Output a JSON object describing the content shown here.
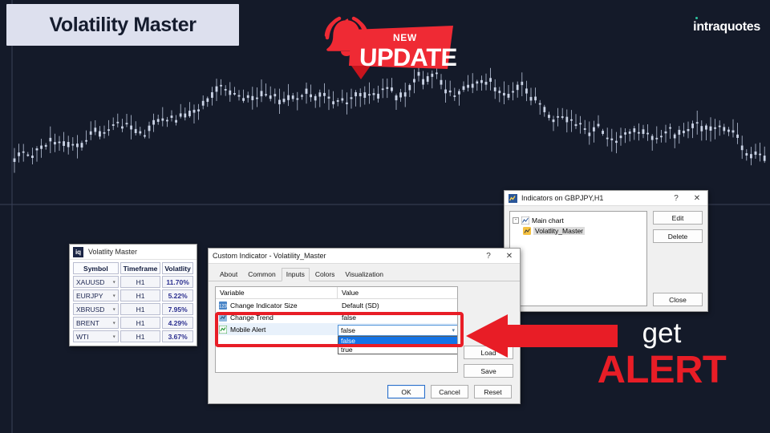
{
  "banner": {
    "title": "Volatility Master"
  },
  "brand": {
    "name": "intraquotes",
    "accent": "#2ec4a0"
  },
  "update_badge": {
    "small_label": "NEW",
    "big_label": "UPDATE",
    "color": "#ef2a34",
    "icon": "bell-icon"
  },
  "cta": {
    "line1": "get",
    "line2": "ALERT",
    "alert_color": "#e81d26"
  },
  "volatility_panel": {
    "icon": "iq",
    "title": "Volatlity Master",
    "columns": [
      "Symbol",
      "Timeframe",
      "Volatlity"
    ],
    "rows": [
      {
        "symbol": "XAUUSD",
        "timeframe": "H1",
        "volatility": "11.70%"
      },
      {
        "symbol": "EURJPY",
        "timeframe": "H1",
        "volatility": "5.22%"
      },
      {
        "symbol": "XBRUSD",
        "timeframe": "H1",
        "volatility": "7.95%"
      },
      {
        "symbol": "BRENT",
        "timeframe": "H1",
        "volatility": "4.29%"
      },
      {
        "symbol": "WTI",
        "timeframe": "H1",
        "volatility": "3.67%"
      }
    ]
  },
  "indicators_window": {
    "title": "Indicators on GBPJPY,H1",
    "help_label": "?",
    "close_label": "✕",
    "tree": {
      "root": "Main chart",
      "child": "Volatlity_Master"
    },
    "buttons": {
      "edit": "Edit",
      "delete": "Delete",
      "close": "Close"
    }
  },
  "custom_indicator_window": {
    "title": "Custom Indicator - Volatility_Master",
    "help_label": "?",
    "close_label": "✕",
    "tabs": [
      {
        "label": "About",
        "active": false
      },
      {
        "label": "Common",
        "active": false
      },
      {
        "label": "Inputs",
        "active": true
      },
      {
        "label": "Colors",
        "active": false
      },
      {
        "label": "Visualization",
        "active": false
      }
    ],
    "grid_headers": {
      "variable": "Variable",
      "value": "Value"
    },
    "rows": [
      {
        "variable": "Change Indicator Size",
        "value": "Default (SD)"
      },
      {
        "variable": "Change Trend",
        "value": "false"
      },
      {
        "variable": "Mobile Alert",
        "value": "false"
      }
    ],
    "combobox": {
      "value": "false",
      "options": [
        "false",
        "true"
      ],
      "selected": "false"
    },
    "side_buttons": {
      "load": "Load",
      "save": "Save"
    },
    "footer_buttons": {
      "ok": "OK",
      "cancel": "Cancel",
      "reset": "Reset"
    }
  },
  "chart": {
    "background": "#141a29",
    "candle_color": "#c9d2e4"
  }
}
